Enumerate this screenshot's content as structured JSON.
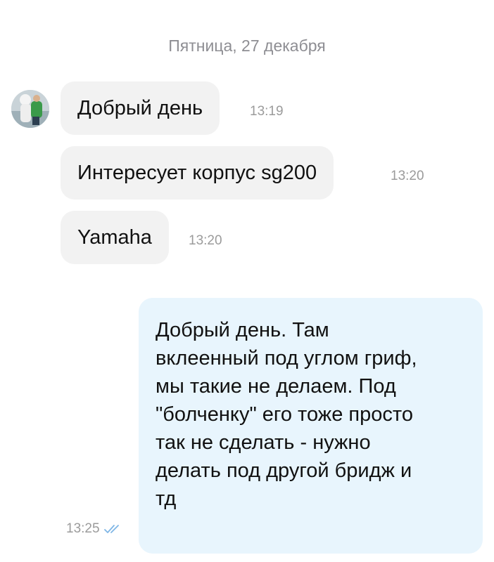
{
  "date_separator": "Пятница, 27 декабря",
  "incoming": [
    {
      "text": "Добрый день",
      "time": "13:19"
    },
    {
      "text": "Интересует корпус sg200",
      "time": "13:20"
    },
    {
      "text": "Yamaha",
      "time": "13:20"
    }
  ],
  "outgoing": {
    "lines": [
      "Добрый день. Там",
      "вклеенный под углом гриф,",
      "мы такие не делаем. Под",
      "\"болченку\" его тоже просто",
      "так не сделать - нужно",
      "делать под другой бридж и",
      "тд"
    ],
    "time": "13:25",
    "status_icon": "double-check-icon",
    "status_color": "#7fb6e6"
  },
  "colors": {
    "incoming_bubble": "#f2f2f2",
    "outgoing_bubble": "#e8f5fd",
    "meta_text": "#9b9b9b"
  }
}
